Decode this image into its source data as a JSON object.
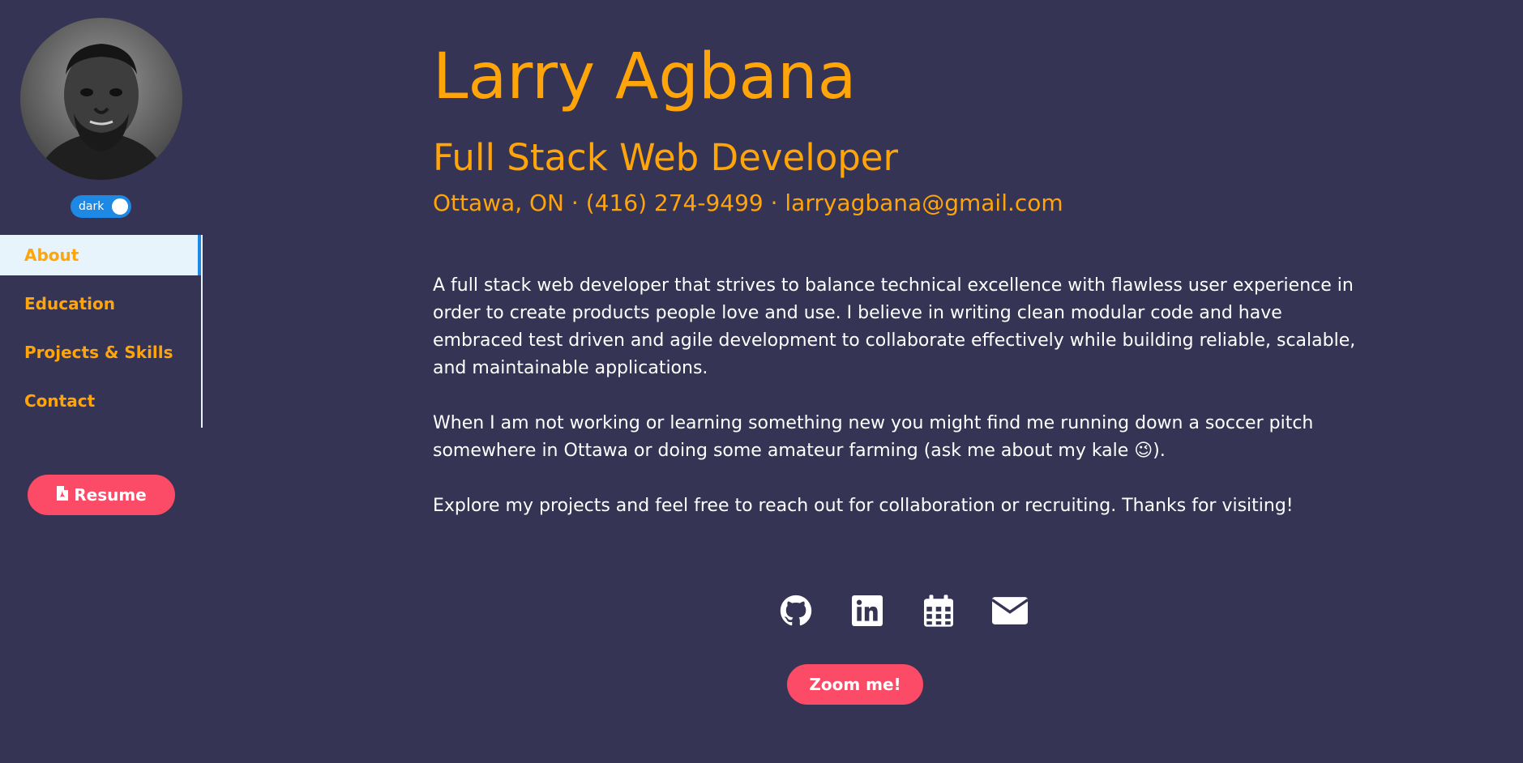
{
  "sidebar": {
    "toggle_label": "dark",
    "nav": [
      {
        "label": "About",
        "active": true
      },
      {
        "label": "Education",
        "active": false
      },
      {
        "label": "Projects & Skills",
        "active": false
      },
      {
        "label": "Contact",
        "active": false
      }
    ],
    "resume_label": "Resume",
    "resume_icon": "pdf-file-icon"
  },
  "header": {
    "name": "Larry Agbana",
    "role": "Full Stack Web Developer",
    "contact_line": "Ottawa, ON · (416) 274-9499 · larryagbana@gmail.com"
  },
  "bio": [
    "A full stack web developer that strives to balance technical excellence with flawless user experience in order to create products people love and use. I believe in writing clean modular code and have embraced test driven and agile development to collaborate effectively while building reliable, scalable, and maintainable applications.",
    "When I am not working or learning something new you might find me running down a soccer pitch somewhere in Ottawa or doing some amateur farming (ask me about my kale 😉).",
    "Explore my projects and feel free to reach out for collaboration or recruiting. Thanks for visiting!"
  ],
  "socials": [
    {
      "icon": "github-icon"
    },
    {
      "icon": "linkedin-icon"
    },
    {
      "icon": "calendar-icon"
    },
    {
      "icon": "email-icon"
    }
  ],
  "zoom_label": "Zoom me!",
  "colors": {
    "background": "#353455",
    "accent": "#ffa409",
    "button": "#fb4b66",
    "toggle": "#1e88e5",
    "nav_active_bg": "#e8f4fb"
  }
}
